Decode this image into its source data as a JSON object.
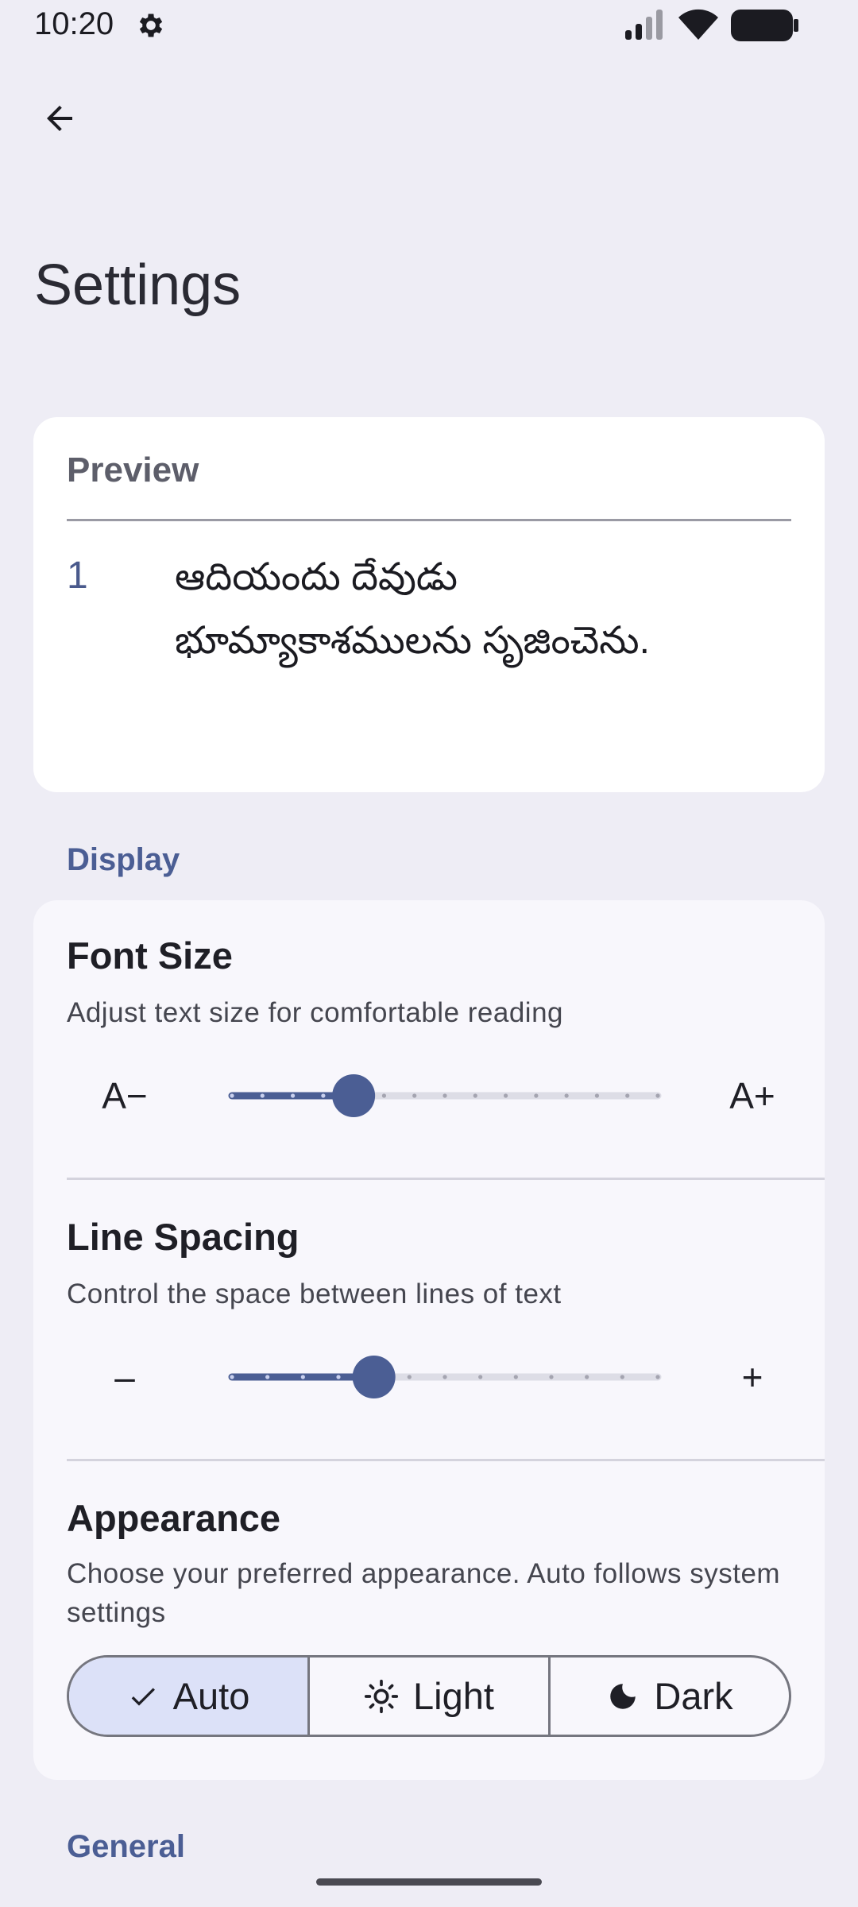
{
  "status_bar": {
    "time": "10:20",
    "icons": [
      "gear-icon",
      "signal-icon",
      "wifi-icon",
      "battery-icon"
    ]
  },
  "header": {
    "back_icon": "arrow-back-icon",
    "title": "Settings"
  },
  "preview": {
    "title": "Preview",
    "verse_number": "1",
    "verse_text": "ఆదియందు దేవుడు భూమ్యాకాశములను సృజించెను."
  },
  "sections": {
    "display_label": "Display",
    "general_label": "General"
  },
  "font_size": {
    "title": "Font Size",
    "description": "Adjust text size for comfortable reading",
    "decrease_label": "A−",
    "increase_label": "A+",
    "steps": 15,
    "selected_step": 4
  },
  "line_spacing": {
    "title": "Line Spacing",
    "description": "Control the space between lines of text",
    "decrease_label": "–",
    "increase_label": "+",
    "steps": 13,
    "selected_step": 4
  },
  "appearance": {
    "title": "Appearance",
    "description": "Choose your preferred appearance. Auto follows system settings",
    "options": [
      {
        "label": "Auto",
        "icon": "check-icon",
        "selected": true
      },
      {
        "label": "Light",
        "icon": "sun-icon",
        "selected": false
      },
      {
        "label": "Dark",
        "icon": "moon-icon",
        "selected": false
      }
    ]
  },
  "colors": {
    "accent": "#4b5e94",
    "slider_active": "#4b5e94",
    "slider_inactive": "#dddde6",
    "segment_selected": "#dce1f8"
  }
}
